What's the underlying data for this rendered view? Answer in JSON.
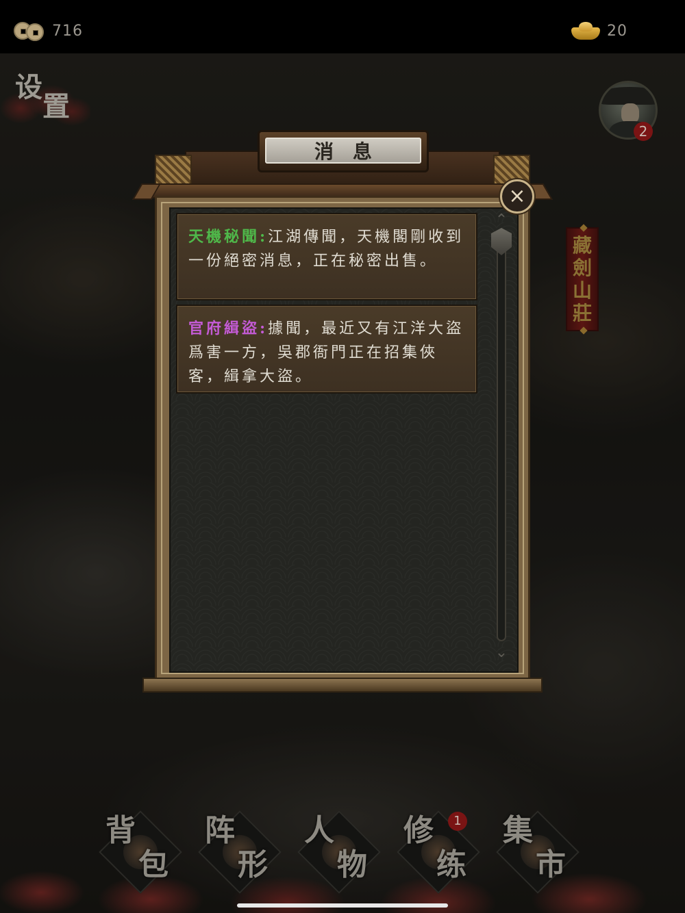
{
  "status_bar": {
    "coins": {
      "icon": "copper-coins-icon",
      "value": "716"
    },
    "gold": {
      "icon": "gold-ingot-icon",
      "value": "20"
    }
  },
  "settings": {
    "label_1": "设",
    "label_2": "置"
  },
  "avatar": {
    "badge": "2"
  },
  "location_banner": {
    "chars": [
      "藏",
      "劍",
      "山",
      "莊"
    ]
  },
  "dialog": {
    "title": "消息",
    "close_icon": "close-icon",
    "messages": [
      {
        "label": "天機秘聞:",
        "label_color": "#4fb84a",
        "text": "江湖傳聞，天機閣剛收到一份絕密消息，正在秘密出售。"
      },
      {
        "label": "官府緝盜:",
        "label_color": "#c45bd6",
        "text": "據聞，最近又有江洋大盜爲害一方，吳郡衙門正在招集俠客，緝拿大盜。"
      }
    ]
  },
  "bottom_nav": {
    "items": [
      {
        "c1": "背",
        "c2": "包"
      },
      {
        "c1": "阵",
        "c2": "形"
      },
      {
        "c1": "人",
        "c2": "物"
      },
      {
        "c1": "修",
        "c2": "练",
        "badge": "1"
      },
      {
        "c1": "集",
        "c2": "市"
      }
    ]
  }
}
